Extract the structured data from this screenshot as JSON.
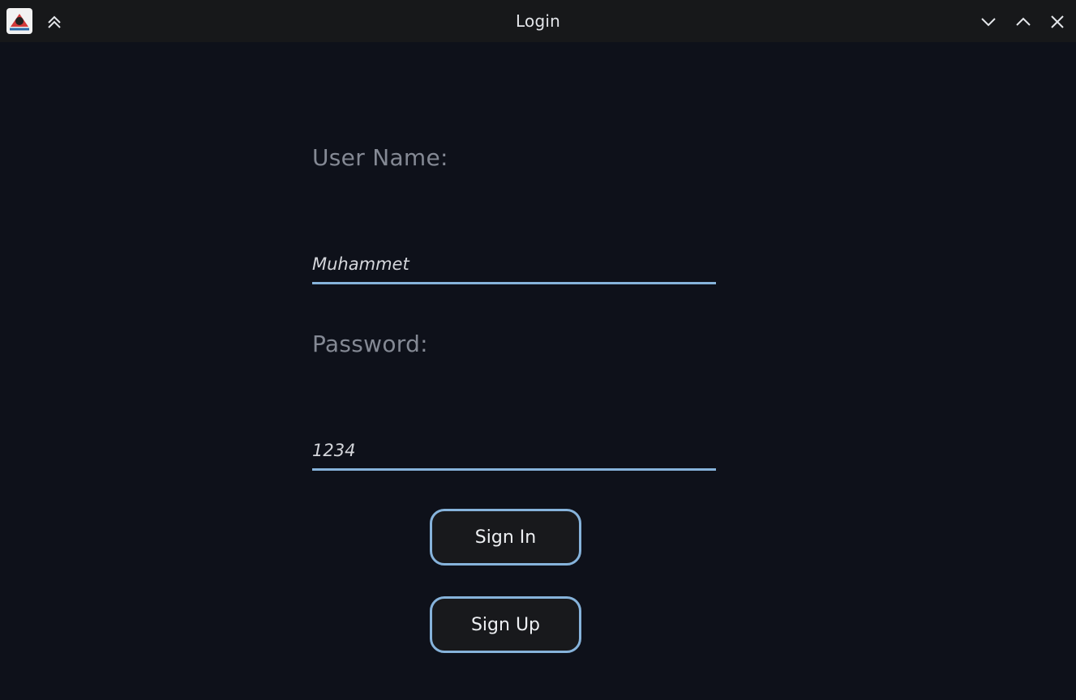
{
  "window": {
    "title": "Login",
    "icons": {
      "app": "java-duke-app-icon",
      "keep_above": "keep-above-icon",
      "minimize": "chevron-down-icon",
      "maximize": "chevron-up-icon",
      "close": "close-icon"
    }
  },
  "form": {
    "username_label": "User Name:",
    "username_value": "Muhammet",
    "password_label": "Password:",
    "password_value": "1234"
  },
  "buttons": {
    "sign_in": "Sign In",
    "sign_up": "Sign Up"
  },
  "colors": {
    "background": "#0e111a",
    "titlebar": "#17181a",
    "accent": "#86b3db",
    "label": "#848994",
    "button_bg": "#18191c"
  }
}
